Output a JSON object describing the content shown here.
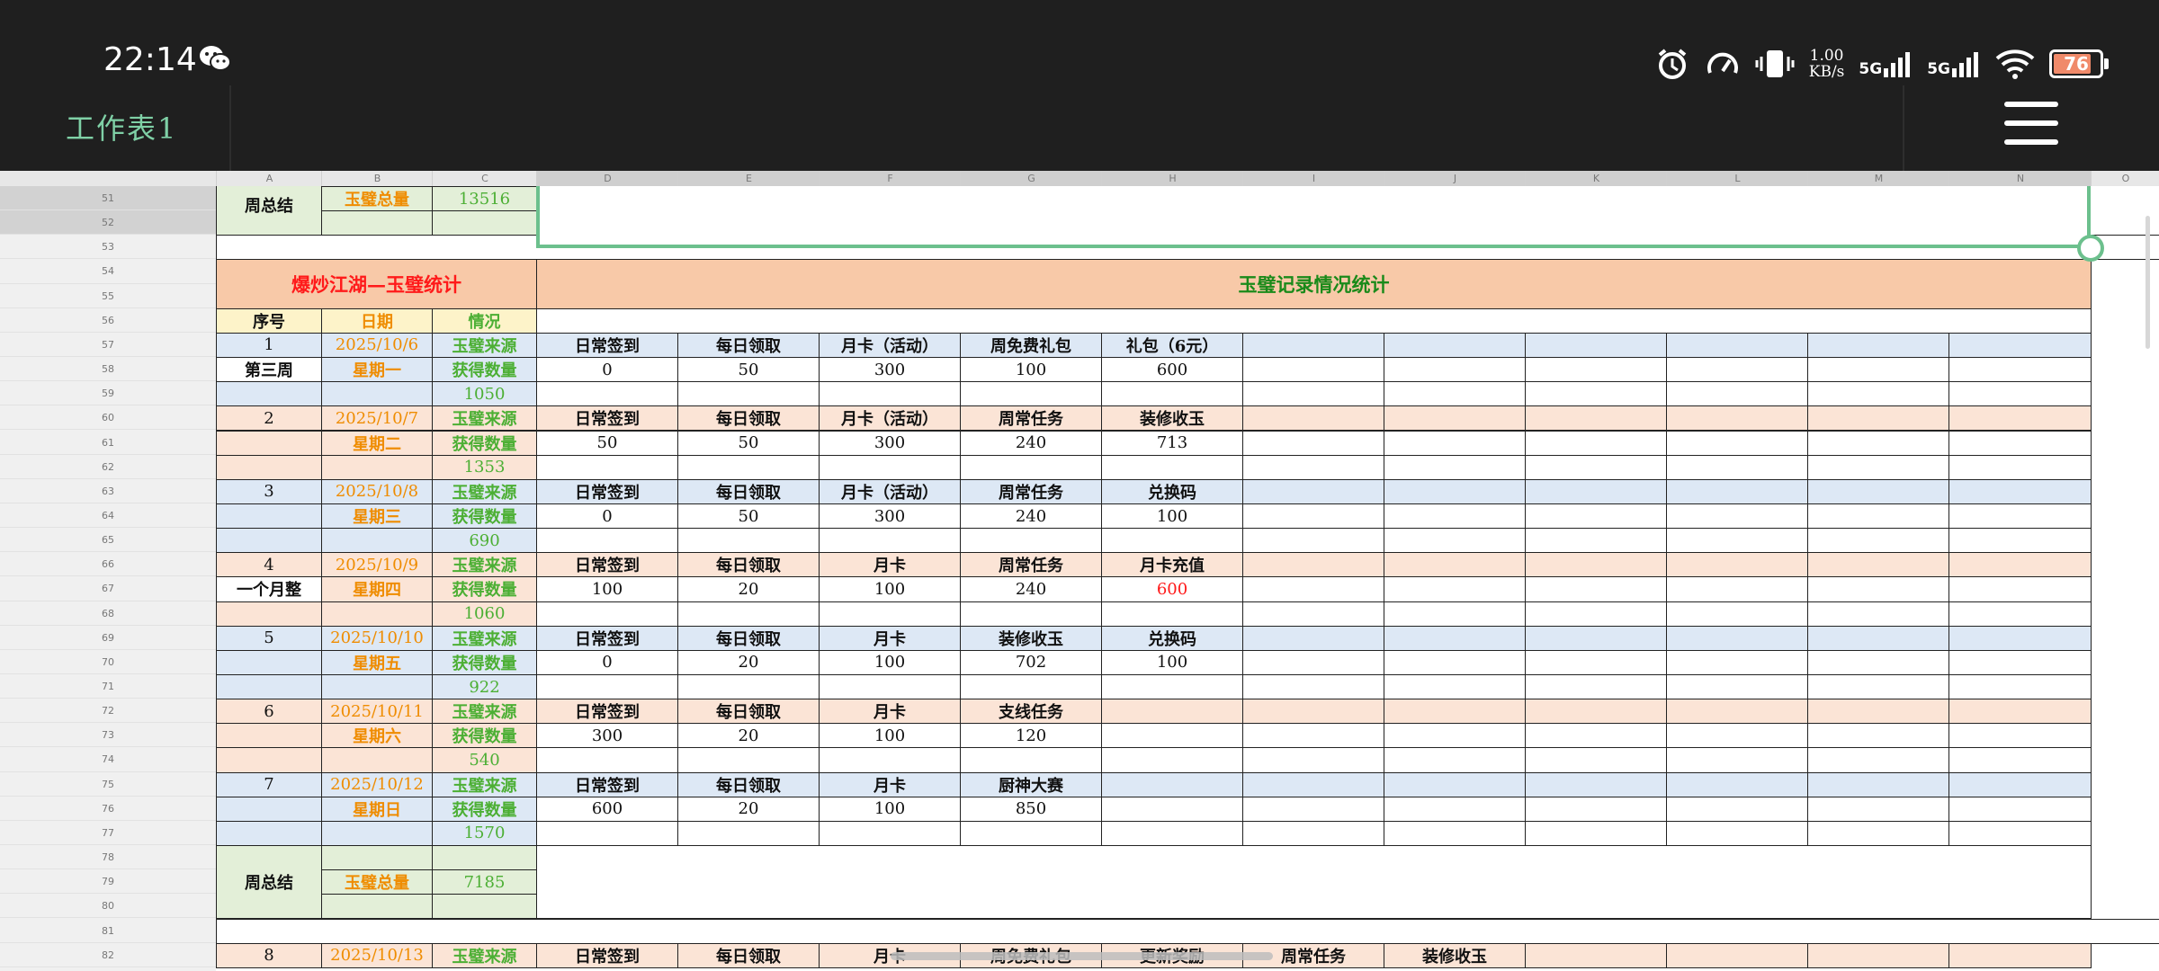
{
  "status_bar": {
    "time": "22:14",
    "speed_value": "1.00",
    "speed_unit": "KB/s",
    "net1": "5G",
    "net2": "5G",
    "battery": "76"
  },
  "header": {
    "sheet_title": "工作表1"
  },
  "columns": [
    "A",
    "B",
    "C",
    "D",
    "E",
    "F",
    "G",
    "H",
    "I",
    "J",
    "K",
    "L",
    "M",
    "N",
    "O"
  ],
  "rows_visible": [
    "51",
    "52",
    "53",
    "54",
    "55",
    "56",
    "57",
    "58",
    "59",
    "60",
    "61",
    "62",
    "63",
    "64",
    "65",
    "66",
    "67",
    "68",
    "69",
    "70",
    "71",
    "72",
    "73",
    "74",
    "75",
    "76",
    "77",
    "78",
    "79",
    "80",
    "81",
    "82"
  ],
  "titles": {
    "left": "爆炒江湖—玉璧统计",
    "right": "玉璧记录情况统计"
  },
  "table_header": [
    "序号",
    "日期",
    "情况"
  ],
  "labels": {
    "source": "玉璧来源",
    "count": "获得数量",
    "week_summary": "周总结",
    "total": "玉璧总量"
  },
  "summary_prev": {
    "total": "13516"
  },
  "days": [
    {
      "idx": "1",
      "date": "2025/10/6",
      "weekday": "星期一",
      "note": "第三周",
      "total": "1050",
      "items": [
        "日常签到",
        "每日领取",
        "月卡（活动）",
        "周免费礼包",
        "礼包（6元）"
      ],
      "values": [
        "0",
        "50",
        "300",
        "100",
        "600"
      ]
    },
    {
      "idx": "2",
      "date": "2025/10/7",
      "weekday": "星期二",
      "note": "",
      "total": "1353",
      "items": [
        "日常签到",
        "每日领取",
        "月卡（活动）",
        "周常任务",
        "装修收玉"
      ],
      "values": [
        "50",
        "50",
        "300",
        "240",
        "713"
      ]
    },
    {
      "idx": "3",
      "date": "2025/10/8",
      "weekday": "星期三",
      "note": "",
      "total": "690",
      "items": [
        "日常签到",
        "每日领取",
        "月卡（活动）",
        "周常任务",
        "兑换码"
      ],
      "values": [
        "0",
        "50",
        "300",
        "240",
        "100"
      ]
    },
    {
      "idx": "4",
      "date": "2025/10/9",
      "weekday": "星期四",
      "note": "一个月整",
      "total": "1060",
      "items": [
        "日常签到",
        "每日领取",
        "月卡",
        "周常任务",
        "月卡充值"
      ],
      "values": [
        "100",
        "20",
        "100",
        "240",
        "600"
      ]
    },
    {
      "idx": "5",
      "date": "2025/10/10",
      "weekday": "星期五",
      "note": "",
      "total": "922",
      "items": [
        "日常签到",
        "每日领取",
        "月卡",
        "装修收玉",
        "兑换码"
      ],
      "values": [
        "0",
        "20",
        "100",
        "702",
        "100"
      ]
    },
    {
      "idx": "6",
      "date": "2025/10/11",
      "weekday": "星期六",
      "note": "",
      "total": "540",
      "items": [
        "日常签到",
        "每日领取",
        "月卡",
        "支线任务"
      ],
      "values": [
        "300",
        "20",
        "100",
        "120"
      ]
    },
    {
      "idx": "7",
      "date": "2025/10/12",
      "weekday": "星期日",
      "note": "",
      "total": "1570",
      "items": [
        "日常签到",
        "每日领取",
        "月卡",
        "厨神大赛"
      ],
      "values": [
        "600",
        "20",
        "100",
        "850"
      ]
    }
  ],
  "summary": {
    "total": "7185"
  },
  "next_day": {
    "idx": "8",
    "date": "2025/10/13",
    "items": [
      "日常签到",
      "每日领取",
      "月卡",
      "周免费礼包",
      "更新奖励",
      "周常任务",
      "装修收玉"
    ]
  },
  "colors": {
    "blue_row": "#dde8f5",
    "peach_row": "#fbe4d6",
    "green_cell": "#e3efd8",
    "title_bg": "#f8c9a8",
    "orange_text": "#ef8c00",
    "green_text": "#4caf34",
    "red_text": "#ff1a1a",
    "dark_green": "#1a8a1a",
    "select_green": "#6cc08d"
  }
}
